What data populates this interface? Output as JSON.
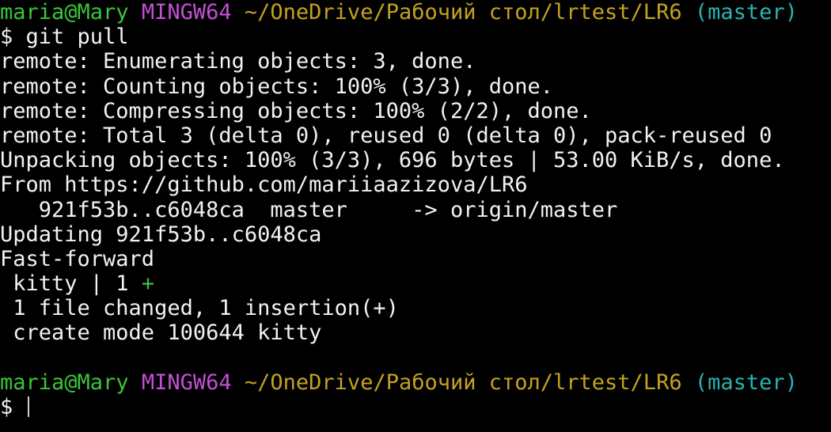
{
  "prompt1": {
    "user": "maria@Mary",
    "env": "MINGW64",
    "path": "~/OneDrive/Рабочий стол/lrtest/LR6",
    "branch": "(master)"
  },
  "command": {
    "symbol": "$",
    "text": "git pull"
  },
  "output": [
    "remote: Enumerating objects: 3, done.",
    "remote: Counting objects: 100% (3/3), done.",
    "remote: Compressing objects: 100% (2/2), done.",
    "remote: Total 3 (delta 0), reused 0 (delta 0), pack-reused 0",
    "Unpacking objects: 100% (3/3), 696 bytes | 53.00 KiB/s, done.",
    "From https://github.com/mariiaazizova/LR6",
    "   921f53b..c6048ca  master     -> origin/master",
    "Updating 921f53b..c6048ca",
    "Fast-forward"
  ],
  "diffstat": {
    "text": " kitty | 1 ",
    "plus": "+"
  },
  "summary": [
    " 1 file changed, 1 insertion(+)",
    " create mode 100644 kitty"
  ],
  "prompt2": {
    "user": "maria@Mary",
    "env": "MINGW64",
    "path": "~/OneDrive/Рабочий стол/lrtest/LR6",
    "branch": "(master)"
  },
  "input_prompt": {
    "symbol": "$"
  },
  "colors": {
    "user": "#3ac53a",
    "env": "#c54fd6",
    "path": "#c3a21f",
    "branch": "#29b3b3",
    "text": "#f2f2f2",
    "background": "#000000"
  }
}
